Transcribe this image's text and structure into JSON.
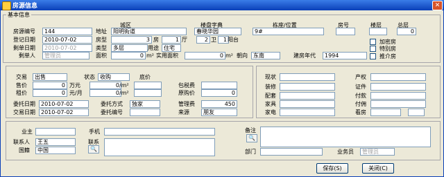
{
  "window": {
    "title": "房源信息",
    "close_glyph": "✕",
    "icon": "house-icon"
  },
  "basic": {
    "legend": "基本信息",
    "col_headers": {
      "district": "城区",
      "estate": "楼盘字典",
      "building": "栋座/位置",
      "unit": "房号",
      "floor": "楼层",
      "total_floors": "总层"
    },
    "fields": {
      "property_no": {
        "label": "房源编号",
        "value": "144"
      },
      "address": {
        "label": "地址",
        "value": "阳明街道"
      },
      "estate": {
        "value": "春晓华园"
      },
      "building": {
        "value": "9#"
      },
      "unit": {
        "value": ""
      },
      "floor": {
        "value": ""
      },
      "total_floors": {
        "value": "0"
      },
      "reg_date": {
        "label": "登记日期",
        "value": "2010-07-02"
      },
      "layout": {
        "label": "房型",
        "rooms": "3",
        "room_unit": "房",
        "halls": "1",
        "hall_unit": "厅",
        "bath": "2",
        "bath_unit": "卫",
        "balcony": "1",
        "balcony_unit": "阳台"
      },
      "dispose_date": {
        "label": "剩单日期",
        "value": "2010-07-02"
      },
      "type": {
        "label": "类型",
        "value": "多层"
      },
      "usage": {
        "label": "用途",
        "value": "住宅"
      },
      "disposer": {
        "label": "剩单人",
        "value": "管理员"
      },
      "area": {
        "label": "面积",
        "value": "0",
        "unit": "m²"
      },
      "usable_area": {
        "label": "实用面积",
        "value": "0",
        "unit": "m²"
      },
      "orientation": {
        "label": "朝向",
        "value": "东南"
      },
      "build_year": {
        "label": "建房年代",
        "value": "1994"
      }
    },
    "checks": {
      "locked": "加密房",
      "special": "特别房",
      "recommended": "推介房"
    }
  },
  "deal": {
    "type": {
      "label": "交易",
      "value": "出售"
    },
    "status": {
      "label": "状态",
      "value": "收购"
    },
    "base_price_label": "底价",
    "sale_price": {
      "label": "售价",
      "value": "0",
      "unit": "万元"
    },
    "sale_unit_price": {
      "value": "0",
      "unit": "/m²"
    },
    "rent": {
      "label": "租价",
      "value": "0",
      "unit": "元/月"
    },
    "rent_unit_price": {
      "value": "0",
      "unit": "/m²"
    },
    "tax_included": {
      "label": "包税费",
      "value": ""
    },
    "original_price": {
      "label": "原购价",
      "value": "0"
    },
    "commission_date": {
      "label": "委托日期",
      "value": "2010-07-02"
    },
    "commission_method": {
      "label": "委托方式",
      "value": "独家"
    },
    "mgmt_fee": {
      "label": "管理费",
      "value": "450"
    },
    "trade_date": {
      "label": "交易日期",
      "value": "2010-07-02"
    },
    "commission_no": {
      "label": "委托编号",
      "value": ""
    },
    "source": {
      "label": "来源",
      "value": "朋友"
    }
  },
  "status_panel": {
    "condition": {
      "label": "现状",
      "value": ""
    },
    "ownership": {
      "label": "产权",
      "value": ""
    },
    "decoration": {
      "label": "装修",
      "value": ""
    },
    "certificate": {
      "label": "证件",
      "value": ""
    },
    "facilities": {
      "label": "配套",
      "value": ""
    },
    "payment": {
      "label": "付款",
      "value": ""
    },
    "furniture": {
      "label": "家具",
      "value": ""
    },
    "commission_fee": {
      "label": "付佣",
      "value": ""
    },
    "appliances": {
      "label": "家电",
      "value": ""
    },
    "viewing": {
      "label": "看房",
      "value": ""
    }
  },
  "owner": {
    "owner": {
      "label": "业主",
      "value": ""
    },
    "mobile": {
      "label": "手机",
      "value": ""
    },
    "contact_person": {
      "label": "联系人",
      "value": "王五"
    },
    "contact": {
      "label": "联系",
      "value": ""
    },
    "nationality": {
      "label": "国籍",
      "value": "中国"
    },
    "notes": {
      "label": "备注",
      "value": ""
    },
    "department": {
      "label": "部门",
      "value": ""
    },
    "agent": {
      "label": "业务员",
      "value": "管理员"
    }
  },
  "buttons": {
    "save": "保存(S)",
    "close": "关闭(C)"
  },
  "colors": {
    "titlebar": "#0a3fb8",
    "window_bg": "#ece9d8",
    "input_border": "#7f9db9"
  }
}
